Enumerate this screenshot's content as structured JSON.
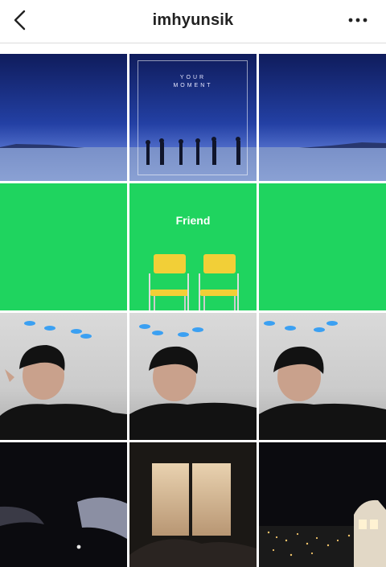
{
  "header": {
    "back_icon": "chevron-left-icon",
    "username": "imhyunsik",
    "more_icon": "ellipsis-icon"
  },
  "posts": [
    {
      "id": 1,
      "kind": "blue-sky-landscape"
    },
    {
      "id": 2,
      "kind": "album-art",
      "text_line1": "YOUR",
      "text_line2": "MOMENT"
    },
    {
      "id": 3,
      "kind": "blue-sky-landscape"
    },
    {
      "id": 4,
      "kind": "green"
    },
    {
      "id": 5,
      "kind": "friend-chairs",
      "label": "Friend"
    },
    {
      "id": 6,
      "kind": "green"
    },
    {
      "id": 7,
      "kind": "selfie"
    },
    {
      "id": 8,
      "kind": "selfie"
    },
    {
      "id": 9,
      "kind": "selfie"
    },
    {
      "id": 10,
      "kind": "night-architecture"
    },
    {
      "id": 11,
      "kind": "window-city"
    },
    {
      "id": 12,
      "kind": "night-cityscape"
    }
  ],
  "colors": {
    "green": "#1fd45f",
    "deep_blue": "#1b2f8a",
    "chair_yellow": "#f2cf37"
  }
}
